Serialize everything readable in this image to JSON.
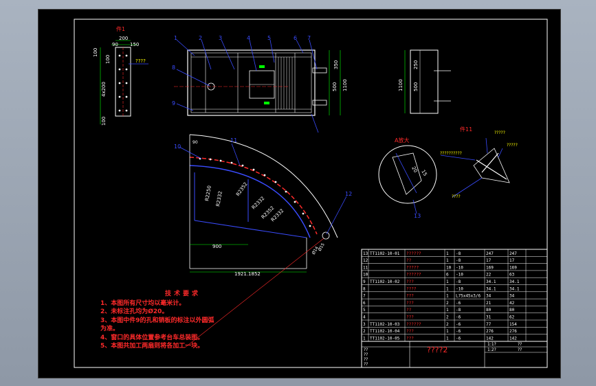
{
  "views": {
    "part1": {
      "title": "件1",
      "dims": [
        "200",
        "90",
        "150",
        "100",
        "100",
        "4x200",
        "100"
      ],
      "note": "????"
    },
    "main": {
      "callouts": [
        "1",
        "2",
        "3",
        "4",
        "5",
        "6",
        "7",
        "8",
        "9"
      ],
      "dims": [
        "350",
        "500",
        "1100"
      ]
    },
    "side": {
      "dims": [
        "250",
        "500",
        "1100"
      ]
    },
    "arc": {
      "callouts": [
        "10",
        "11",
        "12"
      ],
      "dims": [
        "R2250",
        "R2332",
        "R2352",
        "R2332",
        "R2352",
        "R2332",
        "900",
        "1921.1852",
        "90",
        "Ø15",
        "Ø14"
      ]
    },
    "detail_a": {
      "title": "A放大",
      "dims": [
        "20",
        "15"
      ],
      "callout": "13"
    },
    "part11": {
      "title": "件11",
      "notes": [
        "?????",
        "?????",
        "??????????",
        "????"
      ]
    }
  },
  "tech_requirements": {
    "title": "技术要求",
    "items": [
      "1、本图所有尺寸均以毫米计。",
      "2、未标注孔均为Ø20。",
      "3、本图中件9的孔和销板的标注以外圆弧",
      "为准。",
      "4、窗口的具体位置参考台车总装图。",
      "5、本图共加工两扇则将各加工一块。"
    ]
  },
  "title_block": {
    "drawing_title": "????2",
    "right_cells": [
      "1:1?",
      "??",
      "1:2?",
      "??"
    ],
    "left_labels": [
      "??",
      "??",
      "??",
      "??"
    ]
  },
  "bom": [
    [
      "13",
      "TT1102-10-01",
      "??????",
      "1",
      "-8",
      "247",
      "247"
    ],
    [
      "12",
      "",
      "??",
      "1",
      "-8",
      "17",
      "17"
    ],
    [
      "11",
      "",
      "?????",
      "10",
      "-10",
      "169",
      "169"
    ],
    [
      "10",
      "",
      "??????",
      "6",
      "-10",
      "22",
      "63"
    ],
    [
      "9",
      "TT1102-10-02",
      "???",
      "1",
      "-8",
      "34.1",
      "34.1"
    ],
    [
      "8",
      "",
      "????",
      "1",
      "-10",
      "34.1",
      "34.1"
    ],
    [
      "7",
      "",
      "???",
      "1",
      "L75x45x3/6",
      "34",
      "34"
    ],
    [
      "6",
      "",
      "???",
      "2",
      "-6",
      "21",
      "42"
    ],
    [
      "5",
      "",
      "??",
      "1",
      "-8",
      "80",
      "80"
    ],
    [
      "4",
      "",
      "???",
      "2",
      "-6",
      "31",
      "62"
    ],
    [
      "3",
      "TT1102-10-03",
      "??????",
      "2",
      "-6",
      "77",
      "154"
    ],
    [
      "2",
      "TT1102-10-04",
      "???",
      "1",
      "-6",
      "276",
      "276"
    ],
    [
      "1",
      "TT1102-10-05",
      "???",
      "1",
      "-6",
      "142",
      "142"
    ]
  ],
  "colors": {
    "background": "#000000",
    "outline": "#ffffff",
    "red": "#ff2a2a",
    "blue": "#3a4cff",
    "yellow": "#ffff00",
    "green": "#00ff00"
  }
}
